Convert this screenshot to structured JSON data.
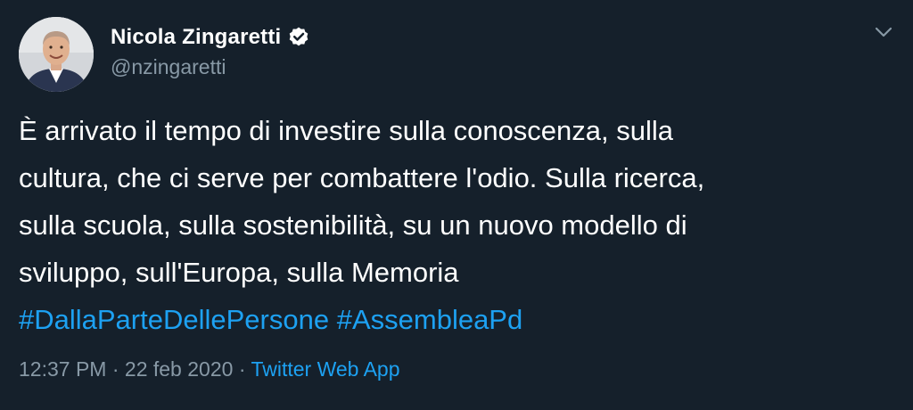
{
  "author": {
    "display_name": "Nicola Zingaretti",
    "handle": "@nzingaretti",
    "verified": true,
    "avatar_icon": "profile-photo"
  },
  "tweet": {
    "lines": [
      "È arrivato il tempo di investire sulla conoscenza, sulla",
      "cultura, che ci serve per combattere l'odio. Sulla ricerca,",
      "sulla scuola, sulla sostenibilità, su un nuovo modello di",
      "sviluppo, sull'Europa, sulla Memoria"
    ],
    "hashtags": [
      "#DallaParteDellePersone",
      "#AssembleaPd"
    ]
  },
  "meta": {
    "time": "12:37 PM",
    "separator": "·",
    "date": "22 feb 2020",
    "source": "Twitter Web App"
  },
  "colors": {
    "background": "#15202b",
    "text": "#ffffff",
    "secondary": "#8899a6",
    "accent": "#1da1f2"
  },
  "icons": {
    "verified": "verified-badge-icon",
    "menu": "chevron-down-icon"
  }
}
